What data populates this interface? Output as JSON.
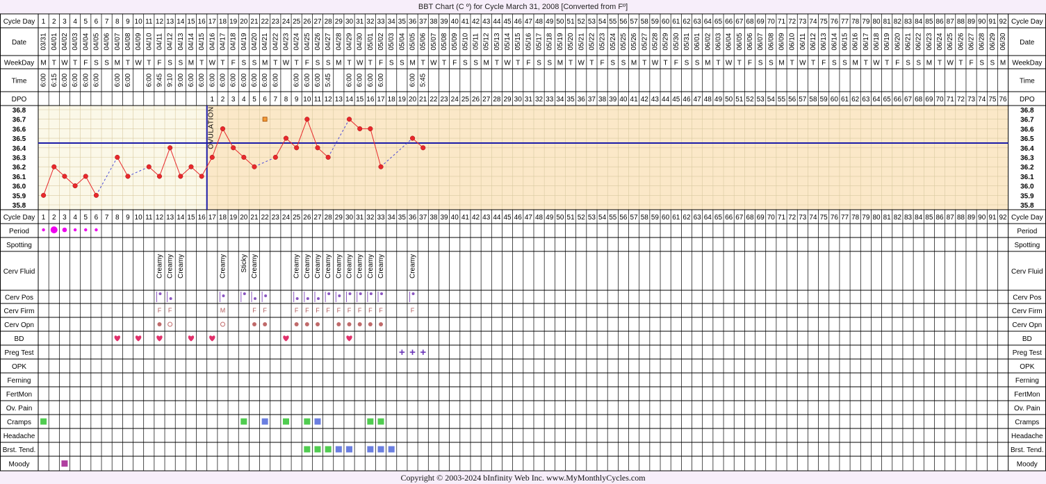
{
  "chart_data": {
    "type": "line",
    "title": "BBT Chart (C º) for Cycle March 31, 2008  [Converted from Fº]",
    "copyright": "Copyright © 2003-2024 bInfinity Web Inc.     www.MyMonthlyCycles.com",
    "ovulation_label": "OVULATION",
    "ovulation_day": 16,
    "coverline": 36.45,
    "ylim": [
      35.8,
      36.8
    ],
    "y_ticks": [
      "36.8",
      "36.7",
      "36.6",
      "36.5",
      "36.4",
      "36.3",
      "36.2",
      "36.1",
      "36.0",
      "35.9",
      "35.8"
    ],
    "row_labels": {
      "cycle_day": "Cycle Day",
      "date": "Date",
      "weekday": "WeekDay",
      "time": "Time",
      "dpo": "DPO",
      "period": "Period",
      "spotting": "Spotting",
      "cerv_fluid": "Cerv Fluid",
      "cerv_pos": "Cerv Pos",
      "cerv_firm": "Cerv Firm",
      "cerv_opn": "Cerv Opn",
      "bd": "BD",
      "preg_test": "Preg Test",
      "opk": "OPK",
      "ferning": "Ferning",
      "fertmon": "FertMon",
      "ov_pain": "Ov. Pain",
      "cramps": "Cramps",
      "headache": "Headache",
      "brst_tend": "Brst. Tend.",
      "moody": "Moody"
    },
    "cycle_days": [
      1,
      2,
      3,
      4,
      5,
      6,
      7,
      8,
      9,
      10,
      11,
      12,
      13,
      14,
      15,
      16,
      17,
      18,
      19,
      20,
      21,
      22,
      23,
      24,
      25,
      26,
      27,
      28,
      29,
      30,
      31,
      32,
      33,
      34,
      35,
      36,
      37,
      38,
      39,
      40,
      41,
      42,
      43,
      44,
      45,
      46,
      47,
      48,
      49,
      50,
      51,
      52,
      53,
      54,
      55,
      56,
      57,
      58,
      59,
      60,
      61,
      62,
      63,
      64,
      65,
      66,
      67,
      68,
      69,
      70,
      71,
      72,
      73,
      74,
      75,
      76,
      77,
      78,
      79,
      80,
      81,
      82,
      83,
      84,
      85,
      86,
      87,
      88,
      89,
      90,
      91,
      92
    ],
    "dates": [
      "03/31",
      "04/01",
      "04/02",
      "04/03",
      "04/04",
      "04/05",
      "04/06",
      "04/07",
      "04/08",
      "04/09",
      "04/10",
      "04/11",
      "04/12",
      "04/13",
      "04/14",
      "04/15",
      "04/16",
      "04/17",
      "04/18",
      "04/19",
      "04/20",
      "04/21",
      "04/22",
      "04/23",
      "04/24",
      "04/25",
      "04/26",
      "04/27",
      "04/28",
      "04/29",
      "04/30",
      "05/01",
      "05/02",
      "05/03",
      "05/04",
      "05/05",
      "05/06",
      "05/07",
      "05/08",
      "05/09",
      "05/10",
      "05/11",
      "05/12",
      "05/13",
      "05/14",
      "05/15",
      "05/16",
      "05/17",
      "05/18",
      "05/19",
      "05/20",
      "05/21",
      "05/22",
      "05/23",
      "05/24",
      "05/25",
      "05/26",
      "05/27",
      "05/28",
      "05/29",
      "05/30",
      "05/31",
      "06/01",
      "06/02",
      "06/03",
      "06/04",
      "06/05",
      "06/06",
      "06/07",
      "06/08",
      "06/09",
      "06/10",
      "06/11",
      "06/12",
      "06/13",
      "06/14",
      "06/15",
      "06/16",
      "06/17",
      "06/18",
      "06/19",
      "06/20",
      "06/21",
      "06/22",
      "06/23",
      "06/24",
      "06/25",
      "06/26",
      "06/27",
      "06/28",
      "06/29",
      "06/30"
    ],
    "weekdays": [
      "M",
      "T",
      "W",
      "T",
      "F",
      "S",
      "S",
      "M",
      "T",
      "W",
      "T",
      "F",
      "S",
      "S",
      "M",
      "T",
      "W",
      "T",
      "F",
      "S",
      "S",
      "M",
      "T",
      "W",
      "T",
      "F",
      "S",
      "S",
      "M",
      "T",
      "W",
      "T",
      "F",
      "S",
      "S",
      "M",
      "T",
      "W",
      "T",
      "F",
      "S",
      "S",
      "M",
      "T",
      "W",
      "T",
      "F",
      "S",
      "S",
      "M",
      "T",
      "W",
      "T",
      "F",
      "S",
      "S",
      "M",
      "T",
      "W",
      "T",
      "F",
      "S",
      "S",
      "M",
      "T",
      "W",
      "T",
      "F",
      "S",
      "S",
      "M",
      "T",
      "W",
      "T",
      "F",
      "S",
      "S",
      "M",
      "T",
      "W",
      "T",
      "F",
      "S",
      "S",
      "M",
      "T",
      "W",
      "T",
      "F",
      "S",
      "S",
      "M"
    ],
    "times": [
      "6:00",
      "6:15",
      "6:00",
      "6:00",
      "6:00",
      "6:00",
      "",
      "6:00",
      "6:00",
      "",
      "6:00",
      "9:45",
      "9:10",
      "9:00",
      "6:00",
      "6:00",
      "6:00",
      "6:00",
      "6:00",
      "6:00",
      "6:00",
      "6:00",
      "6:00",
      "",
      "6:00",
      "6:00",
      "6:00",
      "5:45",
      "",
      "6:00",
      "6:00",
      "6:00",
      "6:00",
      "",
      "",
      "6:00",
      "5:45"
    ],
    "dpo_start_day": 17,
    "dpo": [
      1,
      2,
      3,
      4,
      5,
      6,
      7,
      8,
      9,
      10,
      11,
      12,
      13,
      14,
      15,
      16,
      17,
      18,
      19,
      20,
      21,
      22,
      23,
      24,
      25,
      26,
      27,
      28,
      29,
      30,
      31,
      32,
      33,
      34,
      35,
      36,
      37,
      38,
      39,
      40,
      41,
      42,
      43,
      44,
      45,
      46,
      47,
      48,
      49,
      50,
      51,
      52,
      53,
      54,
      55,
      56,
      57,
      58,
      59,
      60,
      61,
      62,
      63,
      64,
      65,
      66,
      67,
      68,
      69,
      70,
      71,
      72,
      73,
      74,
      75,
      76
    ],
    "temps": [
      35.9,
      36.2,
      36.1,
      36.0,
      36.1,
      35.9,
      null,
      36.3,
      36.1,
      null,
      36.2,
      36.1,
      36.4,
      36.1,
      36.2,
      36.1,
      36.3,
      36.6,
      36.4,
      36.3,
      36.2,
      null,
      36.3,
      36.5,
      36.4,
      36.7,
      36.4,
      36.3,
      null,
      36.7,
      36.6,
      36.6,
      36.2,
      null,
      null,
      36.5,
      36.4
    ],
    "discarded": [
      {
        "day": 22,
        "temp": 36.7
      }
    ],
    "period": [
      {
        "day": 1,
        "size": "small"
      },
      {
        "day": 2,
        "size": "large"
      },
      {
        "day": 3,
        "size": "medium"
      },
      {
        "day": 4,
        "size": "small"
      },
      {
        "day": 5,
        "size": "small"
      },
      {
        "day": 6,
        "size": "small"
      }
    ],
    "cerv_fluid": [
      {
        "day": 12,
        "text": "Creamy"
      },
      {
        "day": 13,
        "text": "Creamy"
      },
      {
        "day": 14,
        "text": "Creamy"
      },
      {
        "day": 18,
        "text": "Creamy"
      },
      {
        "day": 20,
        "text": "Sticky"
      },
      {
        "day": 21,
        "text": "Creamy"
      },
      {
        "day": 25,
        "text": "Creamy"
      },
      {
        "day": 26,
        "text": "Creamy"
      },
      {
        "day": 27,
        "text": "Creamy"
      },
      {
        "day": 28,
        "text": "Creamy"
      },
      {
        "day": 29,
        "text": "Creamy"
      },
      {
        "day": 30,
        "text": "Creamy"
      },
      {
        "day": 31,
        "text": "Creamy"
      },
      {
        "day": 32,
        "text": "Creamy"
      },
      {
        "day": 33,
        "text": "Creamy"
      },
      {
        "day": 36,
        "text": "Creamy"
      }
    ],
    "cerv_pos": [
      {
        "day": 12,
        "level": "high"
      },
      {
        "day": 13,
        "level": "low"
      },
      {
        "day": 18,
        "level": "mid"
      },
      {
        "day": 20,
        "level": "high"
      },
      {
        "day": 21,
        "level": "low"
      },
      {
        "day": 22,
        "level": "mid"
      },
      {
        "day": 25,
        "level": "low"
      },
      {
        "day": 26,
        "level": "low"
      },
      {
        "day": 27,
        "level": "low"
      },
      {
        "day": 28,
        "level": "high"
      },
      {
        "day": 29,
        "level": "mid"
      },
      {
        "day": 30,
        "level": "high"
      },
      {
        "day": 31,
        "level": "high"
      },
      {
        "day": 32,
        "level": "high"
      },
      {
        "day": 33,
        "level": "high"
      },
      {
        "day": 36,
        "level": "high"
      }
    ],
    "cerv_firm": [
      {
        "day": 12,
        "text": "F"
      },
      {
        "day": 13,
        "text": "F"
      },
      {
        "day": 18,
        "text": "M"
      },
      {
        "day": 21,
        "text": "F"
      },
      {
        "day": 22,
        "text": "F"
      },
      {
        "day": 25,
        "text": "F"
      },
      {
        "day": 26,
        "text": "F"
      },
      {
        "day": 27,
        "text": "F"
      },
      {
        "day": 28,
        "text": "F"
      },
      {
        "day": 29,
        "text": "F"
      },
      {
        "day": 30,
        "text": "F"
      },
      {
        "day": 31,
        "text": "F"
      },
      {
        "day": 32,
        "text": "F"
      },
      {
        "day": 33,
        "text": "F"
      },
      {
        "day": 36,
        "text": "F"
      }
    ],
    "cerv_opn": [
      {
        "day": 12,
        "state": "closed"
      },
      {
        "day": 13,
        "state": "open"
      },
      {
        "day": 18,
        "state": "open"
      },
      {
        "day": 21,
        "state": "closed"
      },
      {
        "day": 22,
        "state": "closed"
      },
      {
        "day": 25,
        "state": "closed"
      },
      {
        "day": 26,
        "state": "closed"
      },
      {
        "day": 27,
        "state": "closed"
      },
      {
        "day": 29,
        "state": "closed"
      },
      {
        "day": 30,
        "state": "closed"
      },
      {
        "day": 31,
        "state": "closed"
      },
      {
        "day": 32,
        "state": "closed"
      },
      {
        "day": 33,
        "state": "closed"
      }
    ],
    "bd": [
      8,
      10,
      12,
      15,
      17,
      24,
      30
    ],
    "preg_test": [
      {
        "day": 35,
        "text": "+"
      },
      {
        "day": 36,
        "text": "+"
      },
      {
        "day": 37,
        "text": "+"
      }
    ],
    "cramps": [
      {
        "day": 1,
        "level": "light"
      },
      {
        "day": 20,
        "level": "light"
      },
      {
        "day": 22,
        "level": "medium"
      },
      {
        "day": 24,
        "level": "light"
      },
      {
        "day": 26,
        "level": "light"
      },
      {
        "day": 27,
        "level": "medium"
      },
      {
        "day": 32,
        "level": "light"
      },
      {
        "day": 33,
        "level": "light"
      }
    ],
    "brst_tend": [
      {
        "day": 26,
        "level": "light"
      },
      {
        "day": 27,
        "level": "light"
      },
      {
        "day": 28,
        "level": "light"
      },
      {
        "day": 29,
        "level": "medium"
      },
      {
        "day": 30,
        "level": "medium"
      },
      {
        "day": 32,
        "level": "medium"
      },
      {
        "day": 33,
        "level": "medium"
      },
      {
        "day": 34,
        "level": "medium"
      }
    ],
    "moody": [
      {
        "day": 3,
        "level": "heavy"
      }
    ],
    "colors": {
      "pre_ovulation_bg": "#fbf8e8",
      "post_ovulation_bg": "#fbe8c8",
      "grid": "#d8c9a0",
      "temp_line": "#e8282c",
      "coverline": "#1a1aa8",
      "ovulation_line": "#1a1aa8",
      "period": "#ee00ee",
      "cerv_pos": "#8a55c0",
      "cerv_opn": "#c06a6a",
      "bd": "#e0306a",
      "preg_test": "#6a35b8",
      "light": "#50cc50",
      "medium": "#6a7ee0",
      "heavy": "#b040a0"
    }
  }
}
